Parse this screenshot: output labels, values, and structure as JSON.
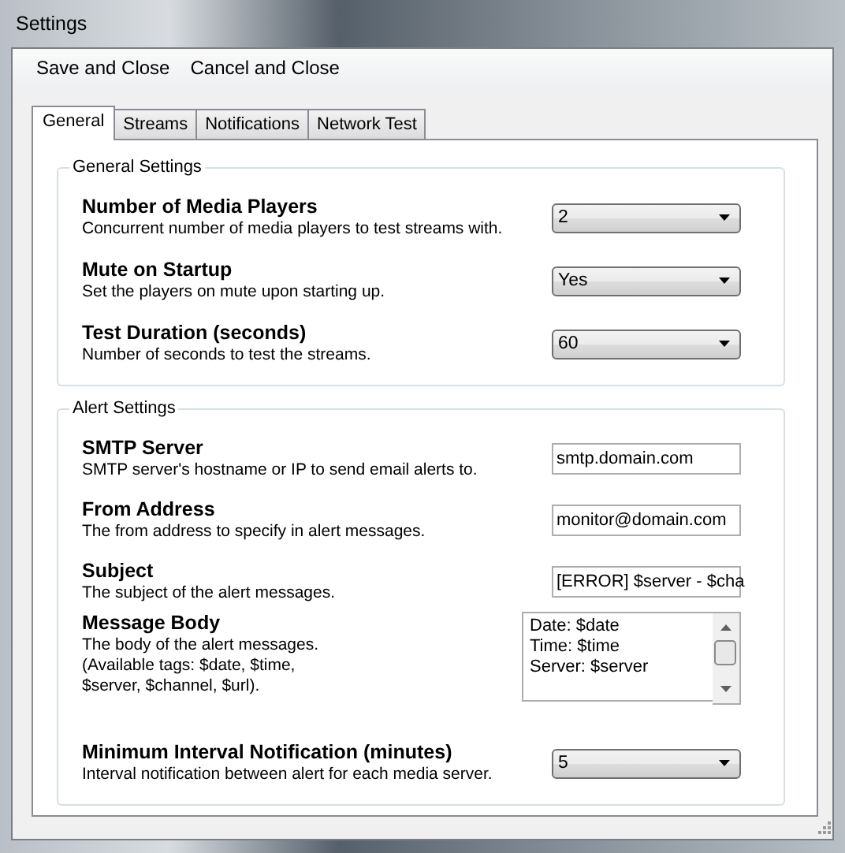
{
  "window": {
    "title": "Settings"
  },
  "menu": [
    {
      "label": "Save and Close"
    },
    {
      "label": "Cancel and Close"
    }
  ],
  "tabs": [
    {
      "label": "General",
      "selected": true
    },
    {
      "label": "Streams",
      "selected": false
    },
    {
      "label": "Notifications",
      "selected": false
    },
    {
      "label": "Network Test",
      "selected": false
    }
  ],
  "groups": [
    {
      "title": "General Settings",
      "rows": [
        {
          "kind": "dropdown",
          "label": "Number of Media Players",
          "description": "Concurrent number of media players to test streams with.",
          "value": "2"
        },
        {
          "kind": "dropdown",
          "label": "Mute on Startup",
          "description": "Set the players on mute upon starting up.",
          "value": "Yes"
        },
        {
          "kind": "dropdown",
          "label": "Test Duration (seconds)",
          "description": "Number of seconds to test the streams.",
          "value": "60"
        }
      ]
    },
    {
      "title": "Alert Settings",
      "rows": [
        {
          "kind": "text",
          "label": "SMTP Server",
          "description": "SMTP server's hostname or IP to send email alerts to.",
          "value": "smtp.domain.com"
        },
        {
          "kind": "text",
          "label": "From Address",
          "description": "The from address to specify in alert messages.",
          "value": "monitor@domain.com"
        },
        {
          "kind": "text",
          "label": "Subject",
          "description": "The subject of the alert messages.",
          "value": "[ERROR] $server - $cha"
        },
        {
          "kind": "textarea",
          "label": "Message Body",
          "description": "The body of the alert messages. (Available tags: $date, $time, $server, $channel, $url).",
          "lines": [
            "Date: $date",
            "Time: $time",
            "Server: $server"
          ]
        },
        {
          "kind": "dropdown",
          "label": "Minimum Interval Notification (minutes)",
          "description": "Interval notification between alert for each media server.",
          "value": "5"
        }
      ]
    }
  ]
}
